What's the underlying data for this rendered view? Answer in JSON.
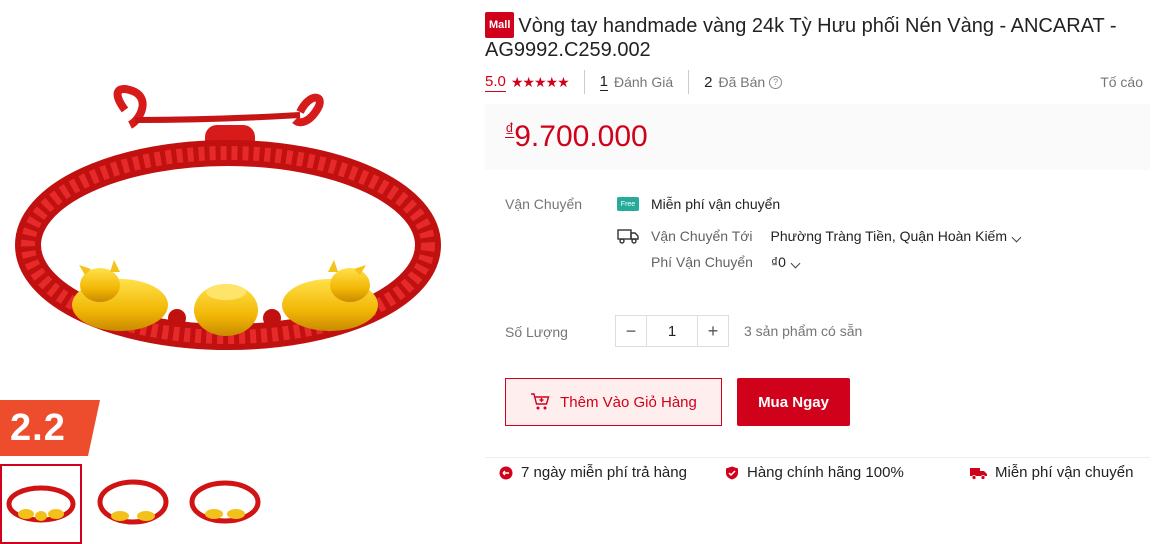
{
  "product": {
    "mall_badge": "Mall",
    "title": "Vòng tay handmade vàng 24k Tỳ Hưu phối Nén Vàng - ANCARAT - AG9992.C259.002",
    "rating_score": "5.0",
    "stars": "★★★★★",
    "review_count": "1",
    "review_label": "Đánh Giá",
    "sold_count": "2",
    "sold_label": "Đã Bán",
    "report_label": "Tố cáo",
    "price_currency": "₫",
    "price": "9.700.000"
  },
  "promo": {
    "badge_text": "2.2"
  },
  "shipping": {
    "label": "Vận Chuyển",
    "free_icon_text": "Free",
    "free_text": "Miễn phí vận chuyển",
    "to_label": "Vận Chuyển Tới",
    "to_value": "Phường Tràng Tiền, Quận Hoàn Kiếm",
    "fee_label": "Phí Vận Chuyển",
    "fee_value": "₫0"
  },
  "quantity": {
    "label": "Số Lượng",
    "minus": "−",
    "value": "1",
    "plus": "+",
    "stock_text": "3 sản phẩm có sẵn"
  },
  "actions": {
    "add_to_cart": "Thêm Vào Giỏ Hàng",
    "buy_now": "Mua Ngay"
  },
  "guarantees": {
    "return": "7 ngày miễn phí trả hàng",
    "authentic": "Hàng chính hãng 100%",
    "free_ship": "Miễn phí vận chuyển"
  },
  "colors": {
    "accent": "#d0011b",
    "promo": "#ee4d2d",
    "free_ship": "#26aa99"
  }
}
